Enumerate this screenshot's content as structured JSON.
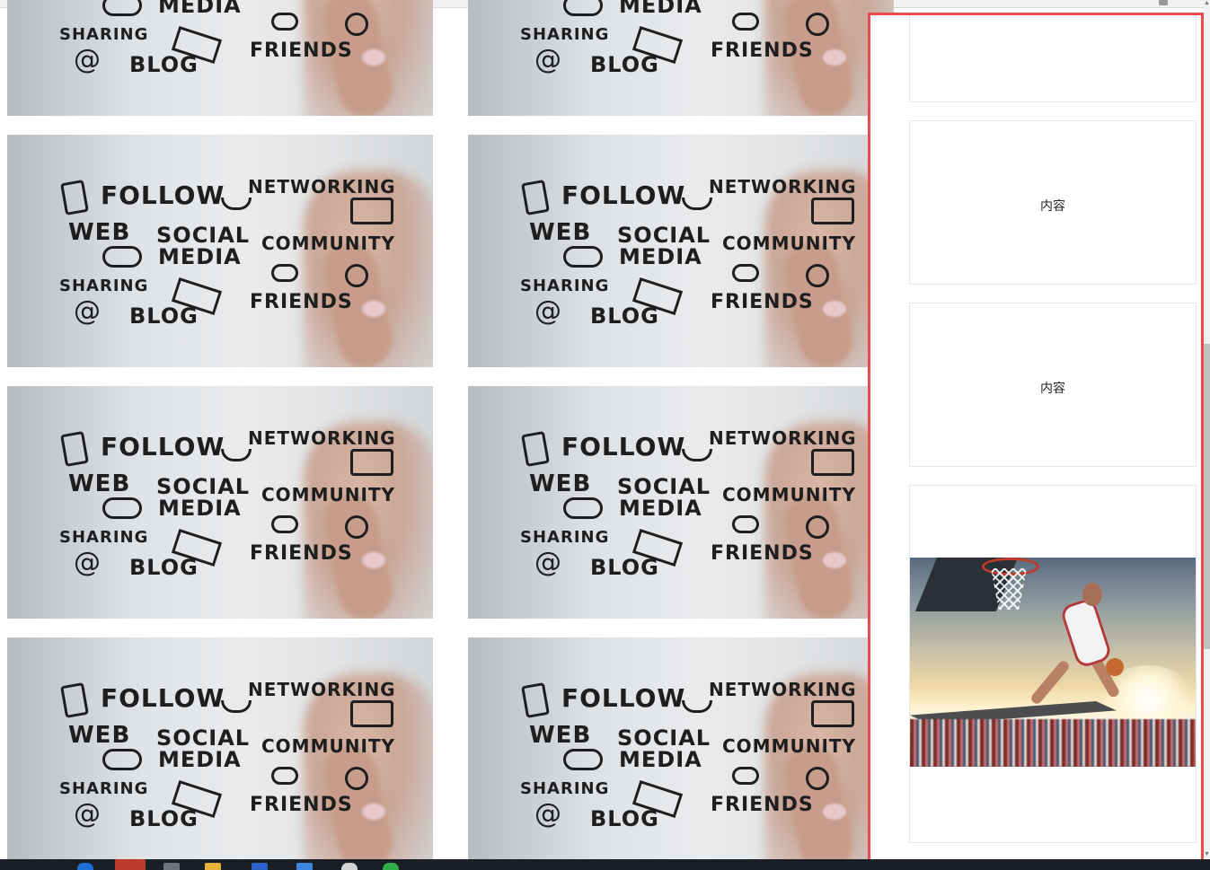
{
  "gallery": {
    "tile_text": {
      "follow": "FOLLOW",
      "networking": "NETWORKING",
      "web": "WEB",
      "social": "SOCIAL",
      "media": "MEDIA",
      "community": "COMMUNITY",
      "sharing": "SHARING",
      "at": "@",
      "blog": "BLOG",
      "friends": "FRIENDS"
    },
    "tile_count": 8
  },
  "side_panel": {
    "highlight_color": "#e84b4b",
    "cards": [
      {
        "label": "内容"
      },
      {
        "label": "内容"
      },
      {
        "label": "内容"
      },
      {
        "label": "",
        "image": "basketball-dunk-photo"
      }
    ]
  },
  "icons": [
    "tablet-icon",
    "coffee-cup-icon",
    "camera-icon",
    "play-icon",
    "chat-icon",
    "user-icon",
    "mail-icon"
  ]
}
